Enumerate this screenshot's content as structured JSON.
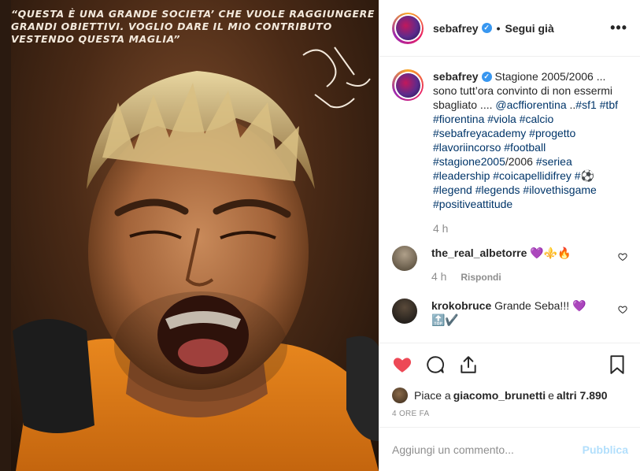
{
  "photo": {
    "quote": "“QUESTA È UNA GRANDE SOCIETA’ CHE VUOLE RAGGIUNGERE\nGRANDI OBIETTIVI. VOGLIO DARE IL MIO CONTRIBUTO\nVESTENDO QUESTA MAGLIA”"
  },
  "header": {
    "username": "sebafrey",
    "separator": "•",
    "follow_label": "Segui già",
    "more_icon": "more-options-icon"
  },
  "caption": {
    "username": "sebafrey",
    "text_plain": "Stagione 2005/2006 ... sono tutt’ora convinto di non essermi sbagliato .... ",
    "mention": "@acffiorentina",
    "sep": " ..",
    "tags_line": "#sf1 #tbf #fiorentina #viola #calcio #sebafreyacademy #progetto #lavoriincorso #football #stagione2005",
    "year_tail": "/2006 ",
    "tags_line2": "#seriea #leadership #coicapellidifrey #",
    "ball": "⚽",
    "tags_line3": "#legend #legends #ilovethisgame #positiveattitude",
    "time": "4 h"
  },
  "comments": [
    {
      "username": "the_real_albetorre",
      "text": "💜⚜️🔥",
      "time": "4 h",
      "reply_label": "Rispondi"
    },
    {
      "username": "krokobruce",
      "text": "Grande Seba!!! 💜",
      "text2": "🔝✔️"
    }
  ],
  "likes": {
    "prefix": "Piace a ",
    "user": "giacomo_brunetti",
    "mid": " e ",
    "others": "altri 7.890"
  },
  "posted_ago": "4 ORE FA",
  "add_comment": {
    "placeholder": "Aggiungi un commento...",
    "publish_label": "Pubblica"
  },
  "colors": {
    "like_red": "#ed4956",
    "link_blue": "#003569",
    "verified_blue": "#3897f0",
    "publish_disabled": "#b2dffc"
  }
}
